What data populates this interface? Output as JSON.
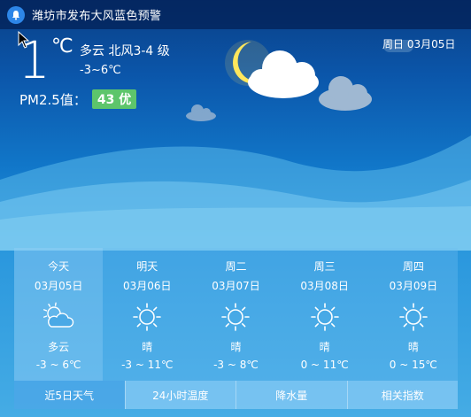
{
  "alert": {
    "text": "潍坊市发布大风蓝色预警"
  },
  "current": {
    "temp": "1",
    "unit": "℃",
    "condition": "多云 北风3-4 级",
    "range": "-3~6℃",
    "pm_label": "PM2.5值：",
    "aqi": "43 优",
    "date": "周日 03月05日"
  },
  "forecast": [
    {
      "name": "今天",
      "date": "03月05日",
      "icon": "partly-cloudy-icon",
      "cond": "多云",
      "range": "-3 ~ 6℃"
    },
    {
      "name": "明天",
      "date": "03月06日",
      "icon": "sun-icon",
      "cond": "晴",
      "range": "-3 ~ 11℃"
    },
    {
      "name": "周二",
      "date": "03月07日",
      "icon": "sun-icon",
      "cond": "晴",
      "range": "-3 ~ 8℃"
    },
    {
      "name": "周三",
      "date": "03月08日",
      "icon": "sun-icon",
      "cond": "晴",
      "range": "0 ~ 11℃"
    },
    {
      "name": "周四",
      "date": "03月09日",
      "icon": "sun-icon",
      "cond": "晴",
      "range": "0 ~ 15℃"
    }
  ],
  "tabs": [
    "近5日天气",
    "24小时温度",
    "降水量",
    "相关指数"
  ],
  "colors": {
    "aqi_good": "#5dc56b",
    "bg_top": "#0a3f86",
    "bg_bottom": "#45ace5"
  }
}
